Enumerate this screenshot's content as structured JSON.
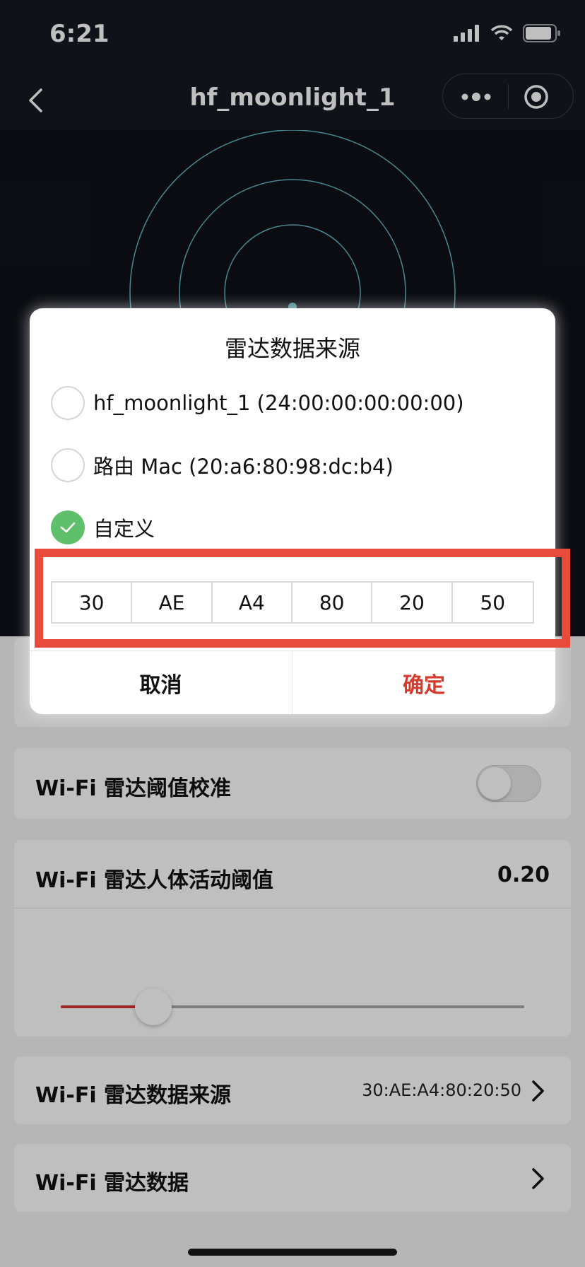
{
  "status_bar": {
    "time": "6:21"
  },
  "nav": {
    "title": "hf_moonlight_1"
  },
  "modal": {
    "title": "雷达数据来源",
    "options": [
      {
        "label": "hf_moonlight_1 (24:00:00:00:00:00)",
        "selected": false
      },
      {
        "label": "路由 Mac (20:a6:80:98:dc:b4)",
        "selected": false
      },
      {
        "label": "自定义",
        "selected": true
      }
    ],
    "mac_fields": [
      "30",
      "AE",
      "A4",
      "80",
      "20",
      "50"
    ],
    "cancel_label": "取消",
    "confirm_label": "确定"
  },
  "settings": {
    "calibration": {
      "title": "Wi-Fi 雷达阈值校准",
      "enabled": false
    },
    "threshold": {
      "title": "Wi-Fi 雷达人体活动阈值",
      "value": "0.20",
      "slider_fraction": 0.2
    },
    "data_source": {
      "title": "Wi-Fi 雷达数据来源",
      "value": "30:AE:A4:80:20:50"
    },
    "radar_data": {
      "title": "Wi-Fi 雷达数据"
    }
  },
  "colors": {
    "accent_red": "#d43a2e",
    "check_green": "#5fbf6b",
    "highlight_red": "#e84a3c",
    "radar_ring": "#5fb6bf"
  },
  "icons": [
    "back-arrow-icon",
    "more-dots-icon",
    "target-icon",
    "signal-icon",
    "wifi-icon",
    "battery-icon",
    "checkmark-icon",
    "chevron-right-icon"
  ]
}
